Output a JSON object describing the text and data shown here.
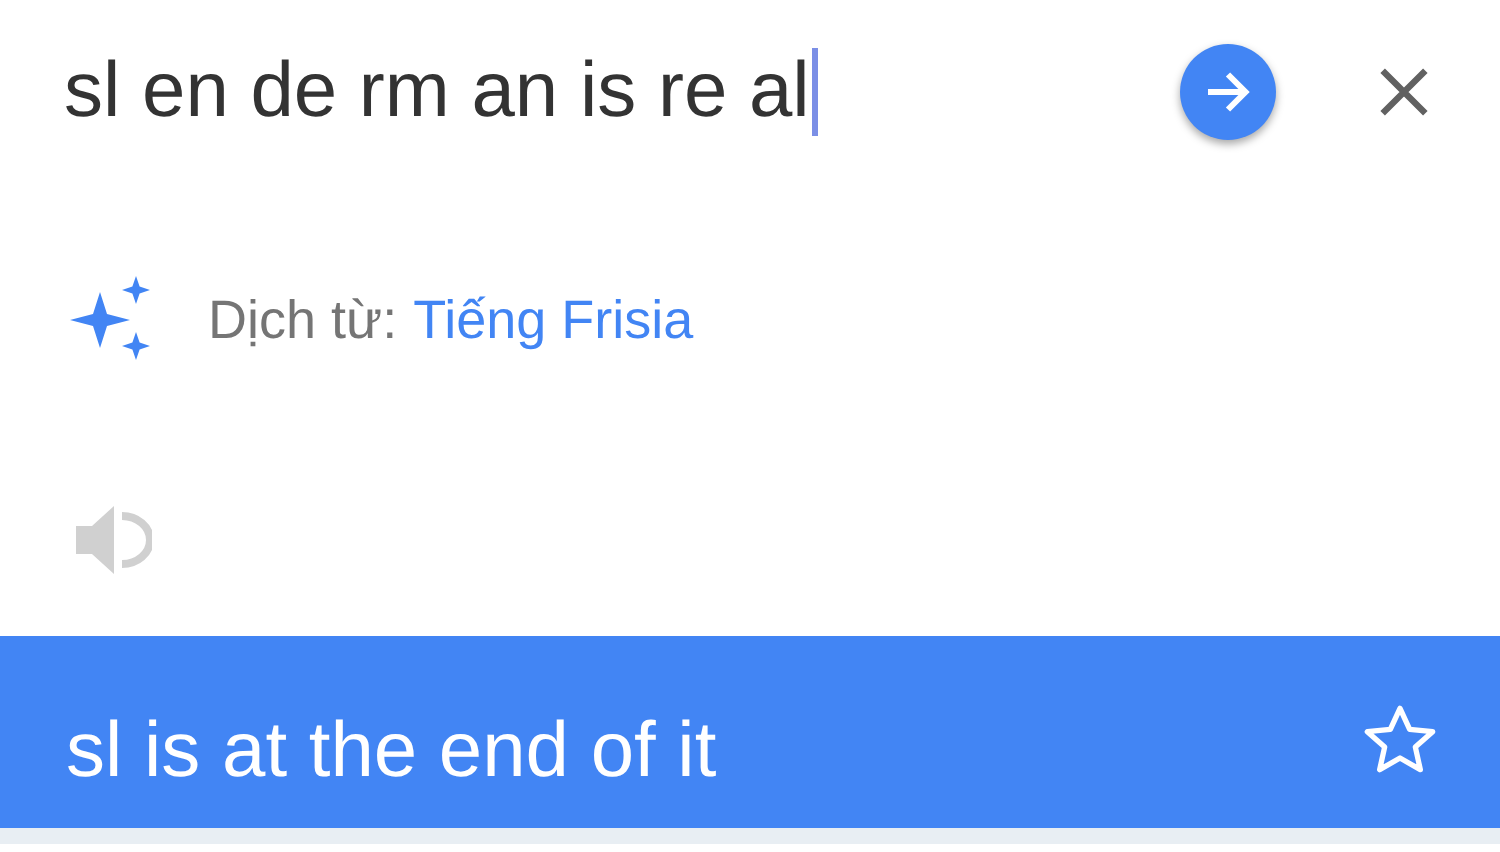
{
  "input": {
    "value": "sl en de rm an is re al"
  },
  "detected": {
    "label": "Dịch từ:",
    "language": "Tiếng Frisia"
  },
  "translation": {
    "text": "sl is at the end of it",
    "starred": false
  }
}
